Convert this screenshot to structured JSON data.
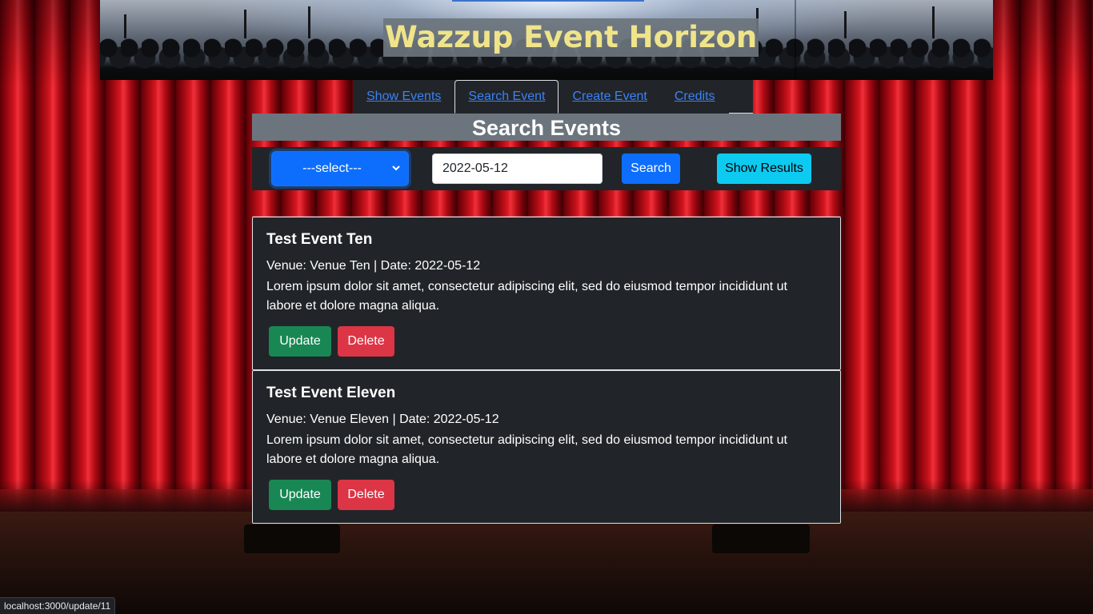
{
  "site_title": "Wazzup Event Horizon",
  "nav": {
    "tabs": [
      {
        "label": "Show Events",
        "active": false
      },
      {
        "label": "Search Event",
        "active": true
      },
      {
        "label": "Create Event",
        "active": false
      },
      {
        "label": "Credits",
        "active": false
      }
    ]
  },
  "page_heading": "Search Events",
  "search": {
    "select_value": "---select---",
    "date_value": "2022-05-12",
    "search_label": "Search",
    "show_results_label": "Show Results"
  },
  "events": [
    {
      "title": "Test Event Ten",
      "meta": "Venue: Venue Ten | Date: 2022-05-12",
      "description": "Lorem ipsum dolor sit amet, consectetur adipiscing elit, sed do eiusmod tempor incididunt ut labore et dolore magna aliqua.",
      "update_label": "Update",
      "delete_label": "Delete"
    },
    {
      "title": "Test Event Eleven",
      "meta": "Venue: Venue Eleven | Date: 2022-05-12",
      "description": "Lorem ipsum dolor sit amet, consectetur adipiscing elit, sed do eiusmod tempor incididunt ut labore et dolore magna aliqua.",
      "update_label": "Update",
      "delete_label": "Delete"
    }
  ],
  "status_bar": {
    "url": "localhost:3000/update/11"
  },
  "colors": {
    "title_text": "#f0e48a",
    "primary": "#0d6efd",
    "info": "#0dcaf0",
    "success": "#198754",
    "danger": "#dc3545",
    "dark": "#212529",
    "secondary": "#6c757d"
  },
  "icons": {
    "select_chevron": "chevron-down-icon"
  }
}
